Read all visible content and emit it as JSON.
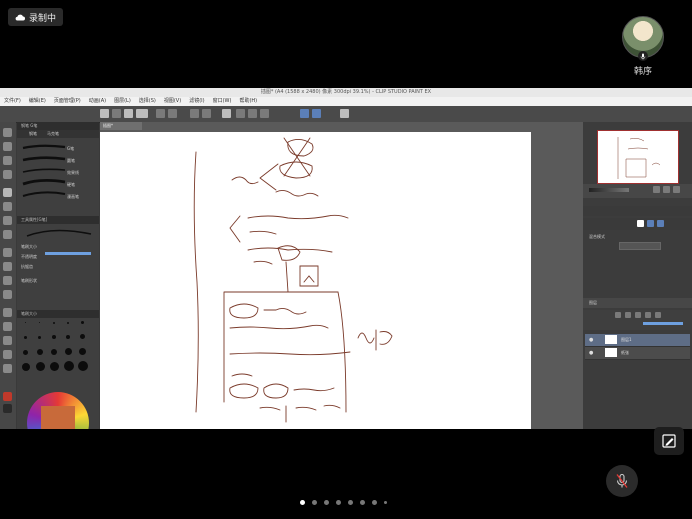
{
  "recording": {
    "label": "录制中",
    "icon": "cloud-icon"
  },
  "participant": {
    "name": "韩序"
  },
  "app": {
    "title": "插图* (A4 (1588 x 2480) 像素 300dpi 39.1%) - CLIP STUDIO PAINT EX",
    "menu": [
      "文件(F)",
      "编辑(E)",
      "页面管理(P)",
      "动画(A)",
      "图层(L)",
      "选择(S)",
      "视图(V)",
      "滤镜(I)",
      "窗口(W)",
      "帮助(H)"
    ],
    "canvas_tab": "插图*",
    "brush_tabs": [
      "钢笔",
      "马克笔"
    ],
    "brush_panel_title": "钢笔 G笔",
    "strokes": [
      "G笔",
      "圆笔",
      "效果线",
      "硬笔",
      "漫画笔"
    ],
    "tool_property": "工具属性[G笔]",
    "properties": [
      "笔刷大小",
      "不透明度",
      "抗锯齿",
      "笔刷形状"
    ],
    "brush_size_panel": "笔刷大小",
    "layer_panel_title": "图层",
    "blend_mode": "混合模式",
    "layers": [
      "图层1",
      "纸张"
    ]
  }
}
